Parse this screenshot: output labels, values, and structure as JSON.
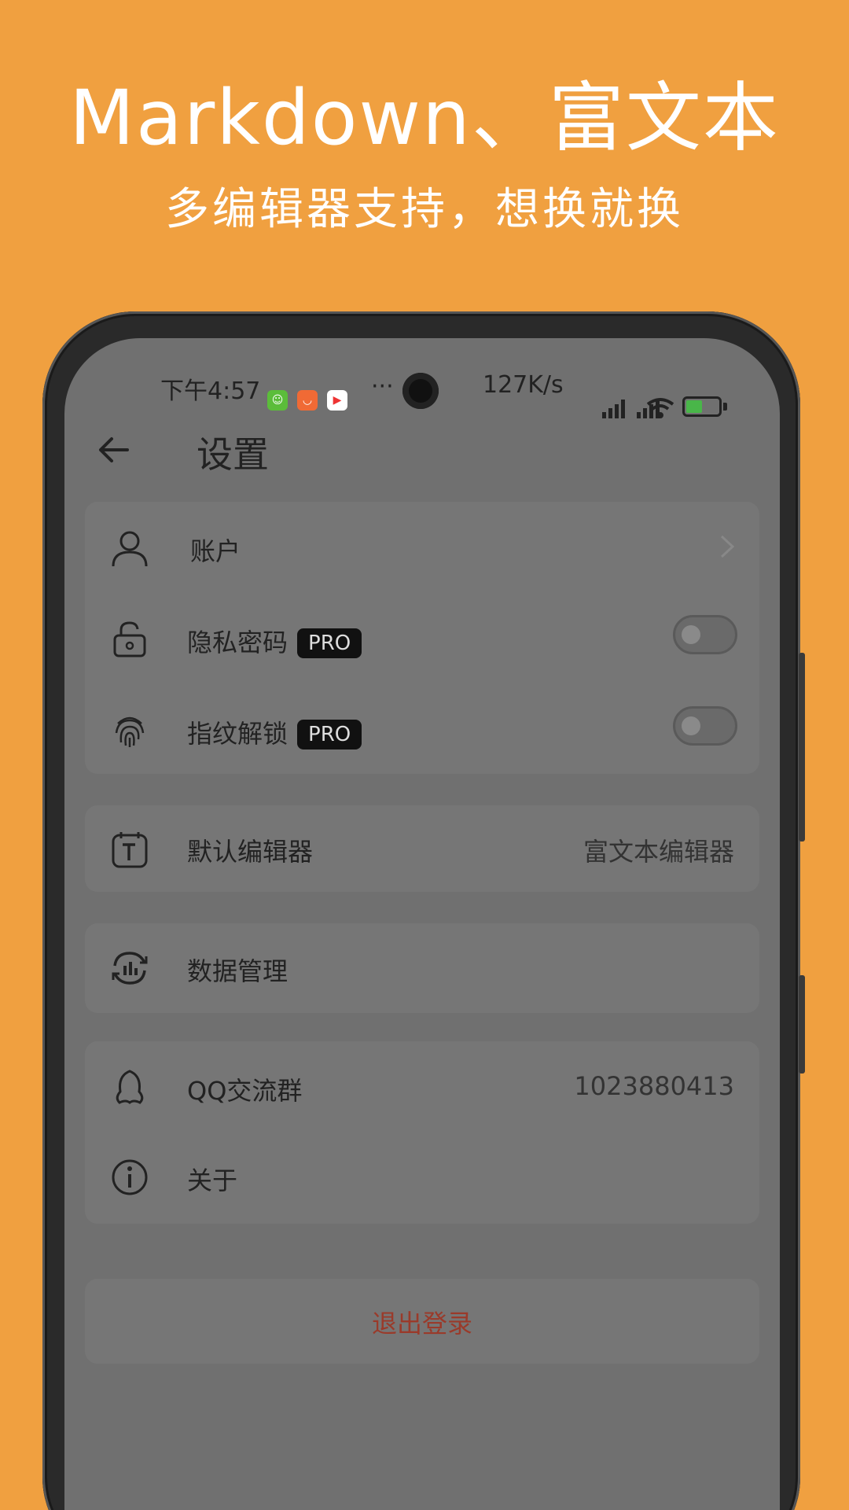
{
  "promo": {
    "title": "Markdown、富文本",
    "subtitle": "多编辑器支持，想换就换"
  },
  "status_bar": {
    "time": "下午4:57",
    "dots": "···",
    "net_speed": "127K/s"
  },
  "header": {
    "title": "设置"
  },
  "settings": {
    "account": {
      "label": "账户"
    },
    "privacy_password": {
      "label": "隐私密码",
      "badge": "PRO",
      "enabled": false
    },
    "fingerprint_unlock": {
      "label": "指纹解锁",
      "badge": "PRO",
      "enabled": false
    },
    "default_editor": {
      "label": "默认编辑器",
      "value": "富文本编辑器"
    },
    "data_management": {
      "label": "数据管理"
    },
    "qq_group": {
      "label": "QQ交流群",
      "value": "1023880413"
    },
    "about": {
      "label": "关于"
    },
    "logout": {
      "label": "退出登录"
    }
  },
  "colors": {
    "background": "#F0A040",
    "screen_overlay": "#707070",
    "logout_text": "#9A3A2A"
  }
}
